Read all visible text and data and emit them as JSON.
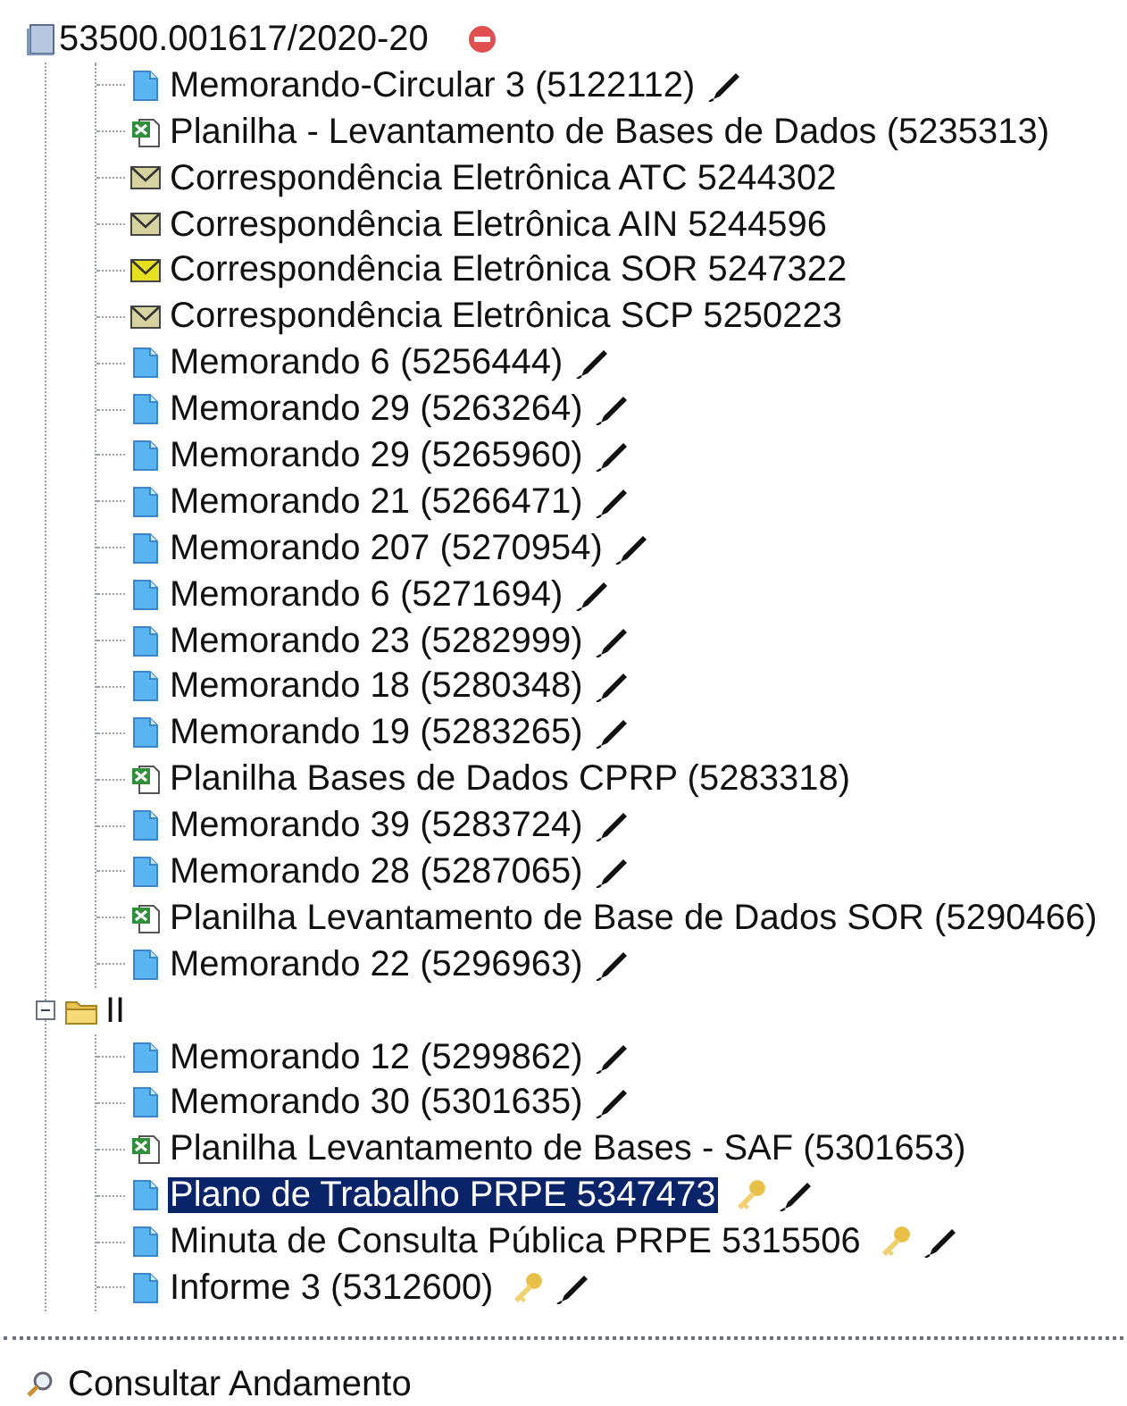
{
  "root": {
    "label": "53500.001617/2020-20",
    "expanded": true
  },
  "items": [
    {
      "kind": "doc",
      "label": "Memorando-Circular 3 (5122112)",
      "signed": true,
      "restricted": false,
      "selected": false
    },
    {
      "kind": "sheet",
      "label": "Planilha - Levantamento de Bases de Dados (5235313)",
      "signed": false,
      "restricted": false,
      "selected": false
    },
    {
      "kind": "email",
      "label": "Correspondência Eletrônica ATC 5244302",
      "color": "#d6d3a0",
      "signed": false,
      "restricted": false,
      "selected": false
    },
    {
      "kind": "email",
      "label": "Correspondência Eletrônica AIN 5244596",
      "color": "#d6d3a0",
      "signed": false,
      "restricted": false,
      "selected": false
    },
    {
      "kind": "email",
      "label": "Correspondência Eletrônica SOR 5247322",
      "color": "#e6e020",
      "signed": false,
      "restricted": false,
      "selected": false
    },
    {
      "kind": "email",
      "label": "Correspondência Eletrônica SCP 5250223",
      "color": "#d6d3a0",
      "signed": false,
      "restricted": false,
      "selected": false
    },
    {
      "kind": "doc",
      "label": "Memorando 6 (5256444)",
      "signed": true,
      "restricted": false,
      "selected": false
    },
    {
      "kind": "doc",
      "label": "Memorando 29 (5263264)",
      "signed": true,
      "restricted": false,
      "selected": false
    },
    {
      "kind": "doc",
      "label": "Memorando 29 (5265960)",
      "signed": true,
      "restricted": false,
      "selected": false
    },
    {
      "kind": "doc",
      "label": "Memorando 21 (5266471)",
      "signed": true,
      "restricted": false,
      "selected": false
    },
    {
      "kind": "doc",
      "label": "Memorando 207 (5270954)",
      "signed": true,
      "restricted": false,
      "selected": false
    },
    {
      "kind": "doc",
      "label": "Memorando 6 (5271694)",
      "signed": true,
      "restricted": false,
      "selected": false
    },
    {
      "kind": "doc",
      "label": "Memorando 23 (5282999)",
      "signed": true,
      "restricted": false,
      "selected": false
    },
    {
      "kind": "doc",
      "label": "Memorando 18 (5280348)",
      "signed": true,
      "restricted": false,
      "selected": false
    },
    {
      "kind": "doc",
      "label": "Memorando 19 (5283265)",
      "signed": true,
      "restricted": false,
      "selected": false
    },
    {
      "kind": "sheet",
      "label": "Planilha Bases de Dados CPRP (5283318)",
      "signed": false,
      "restricted": false,
      "selected": false
    },
    {
      "kind": "doc",
      "label": "Memorando 39 (5283724)",
      "signed": true,
      "restricted": false,
      "selected": false
    },
    {
      "kind": "doc",
      "label": "Memorando 28 (5287065)",
      "signed": true,
      "restricted": false,
      "selected": false
    },
    {
      "kind": "sheet",
      "label": "Planilha Levantamento de Base de Dados SOR (5290466)",
      "signed": false,
      "restricted": false,
      "selected": false
    },
    {
      "kind": "doc",
      "label": "Memorando 22 (5296963)",
      "signed": true,
      "restricted": false,
      "selected": false
    }
  ],
  "folder": {
    "label": "II",
    "expanded": true,
    "children": [
      {
        "kind": "doc",
        "label": "Memorando 12 (5299862)",
        "signed": true,
        "restricted": false,
        "selected": false
      },
      {
        "kind": "doc",
        "label": "Memorando 30 (5301635)",
        "signed": true,
        "restricted": false,
        "selected": false
      },
      {
        "kind": "sheet",
        "label": "Planilha Levantamento de Bases - SAF (5301653)",
        "signed": false,
        "restricted": false,
        "selected": false
      },
      {
        "kind": "doc",
        "label": "Plano de Trabalho PRPE 5347473",
        "signed": true,
        "restricted": true,
        "selected": true
      },
      {
        "kind": "doc",
        "label": "Minuta de Consulta Pública PRPE 5315506",
        "signed": true,
        "restricted": true,
        "selected": false
      },
      {
        "kind": "doc",
        "label": "Informe 3 (5312600)",
        "signed": true,
        "restricted": true,
        "selected": false
      }
    ]
  },
  "footer_link": "Consultar Andamento"
}
